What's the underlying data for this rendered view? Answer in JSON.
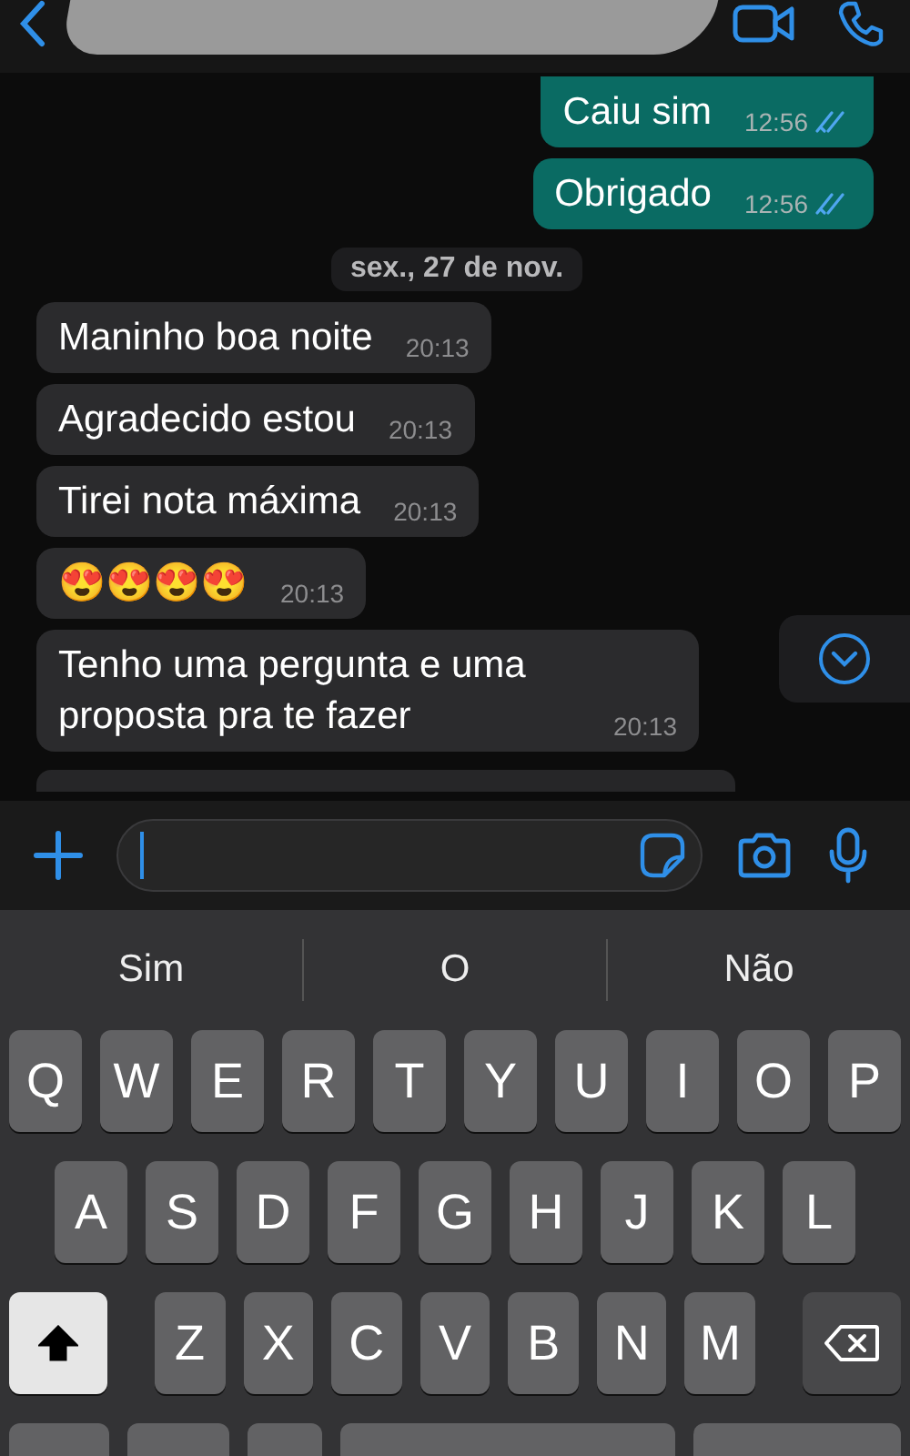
{
  "header": {
    "name_redacted": true
  },
  "messages": [
    {
      "kind": "out",
      "text": "Caiu sim",
      "time": "12:56",
      "read": true
    },
    {
      "kind": "out",
      "text": "Obrigado",
      "time": "12:56",
      "read": true
    },
    {
      "kind": "date",
      "text": "sex., 27 de nov."
    },
    {
      "kind": "in",
      "text": "Maninho boa noite",
      "time": "20:13"
    },
    {
      "kind": "in",
      "text": "Agradecido estou",
      "time": "20:13"
    },
    {
      "kind": "in",
      "text": "Tirei nota máxima",
      "time": "20:13"
    },
    {
      "kind": "in",
      "text": "😍😍😍😍",
      "time": "20:13"
    },
    {
      "kind": "in",
      "text": "Tenho uma pergunta e uma proposta pra te fazer",
      "time": "20:13"
    }
  ],
  "suggestions": [
    "Sim",
    "O",
    "Não"
  ],
  "keyboard": {
    "shift_on": true,
    "rows": [
      [
        "Q",
        "W",
        "E",
        "R",
        "T",
        "Y",
        "U",
        "I",
        "O",
        "P"
      ],
      [
        "A",
        "S",
        "D",
        "F",
        "G",
        "H",
        "J",
        "K",
        "L"
      ],
      [
        "Z",
        "X",
        "C",
        "V",
        "B",
        "N",
        "M"
      ]
    ]
  }
}
